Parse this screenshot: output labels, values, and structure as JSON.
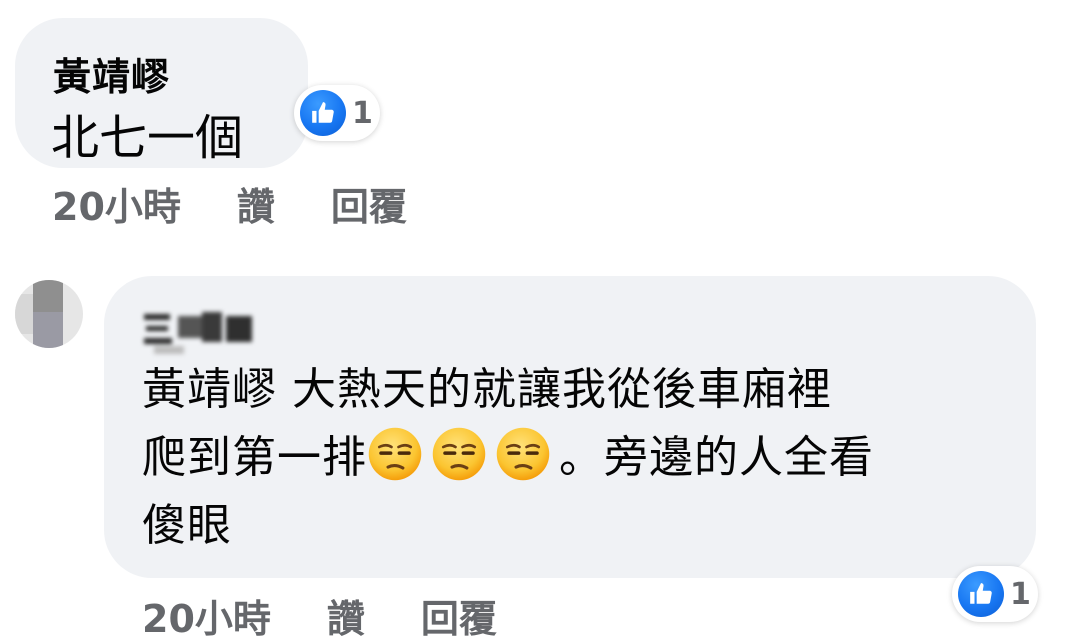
{
  "comments": [
    {
      "author": "黃靖嵺",
      "text": "北七一個",
      "reaction_count": "1",
      "time": "20小時",
      "like_label": "讚",
      "reply_label": "回覆"
    },
    {
      "author": "",
      "mention": "黃靖嵺",
      "text_line1": " 大熱天的就讓我從後車廂裡",
      "text_line2_a": "爬到第一排",
      "text_line2_b": "。旁邊的人全看",
      "text_line3": "傻眼",
      "emoji": "unamused-face-emoji",
      "emoji_count": 3,
      "reaction_count": "1",
      "time": "20小時",
      "like_label": "讚",
      "reply_label": "回覆"
    }
  ],
  "colors": {
    "bubble_bg": "#f0f2f5",
    "meta_text": "#65676b",
    "like_blue": "#1877f2"
  },
  "icons": {
    "reaction": "thumbs-up-icon"
  }
}
